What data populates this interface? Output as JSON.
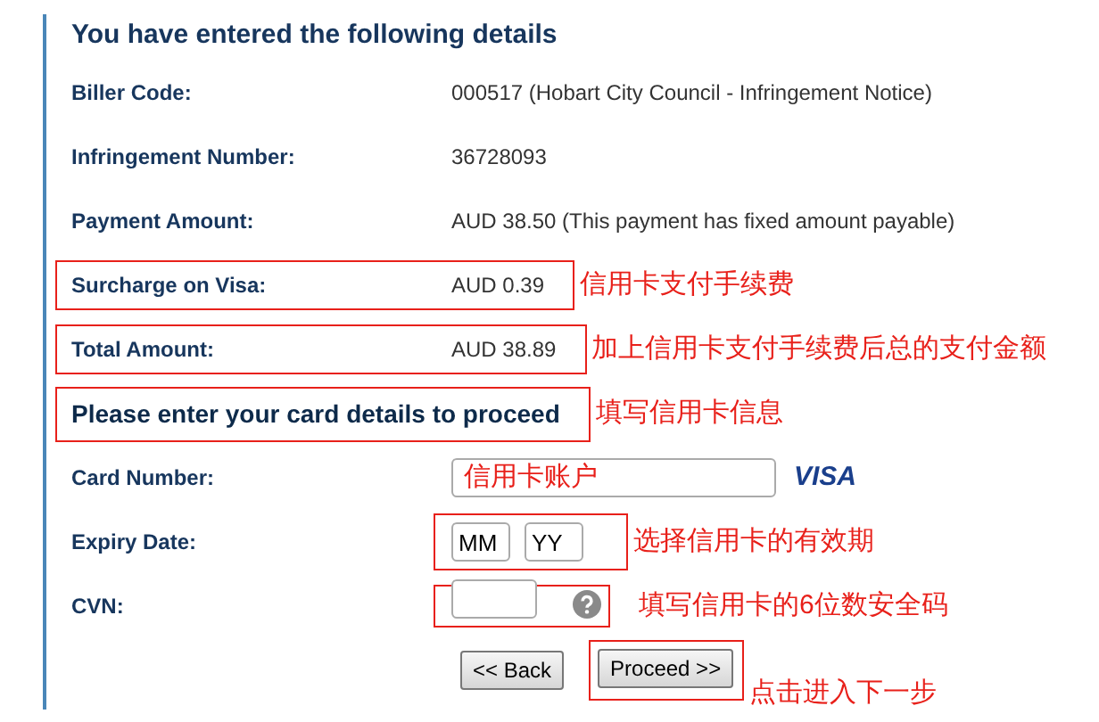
{
  "title": "You have entered the following details",
  "details": [
    {
      "label": "Biller Code:",
      "value": "000517 (Hobart City Council - Infringement Notice)",
      "highlight": false
    },
    {
      "label": "Infringement Number:",
      "value": "36728093",
      "highlight": false
    },
    {
      "label": "Payment Amount:",
      "value": "AUD 38.50 (This payment has fixed amount payable)",
      "highlight": false
    },
    {
      "label": "Surcharge on Visa:",
      "value": "AUD 0.39",
      "highlight": true,
      "note": "信用卡支付手续费"
    },
    {
      "label": "Total Amount:",
      "value": "AUD 38.89",
      "highlight": true,
      "note": "加上信用卡支付手续费后总的支付金额"
    }
  ],
  "section": {
    "heading": "Please enter your card details to proceed",
    "highlight": true,
    "note": "填写信用卡信息"
  },
  "card_number": {
    "label": "Card Number:",
    "value": "信用卡账户",
    "brand": "VISA"
  },
  "expiry": {
    "label": "Expiry Date:",
    "month": "MM",
    "year": "YY",
    "highlight": true,
    "note": "选择信用卡的有效期"
  },
  "cvn": {
    "label": "CVN:",
    "highlight": true,
    "note": "填写信用卡的6位数安全码"
  },
  "buttons": [
    {
      "label": "<< Back",
      "highlight": false
    },
    {
      "label": "Proceed >>",
      "highlight": true,
      "note": "点击进入下一步"
    }
  ]
}
